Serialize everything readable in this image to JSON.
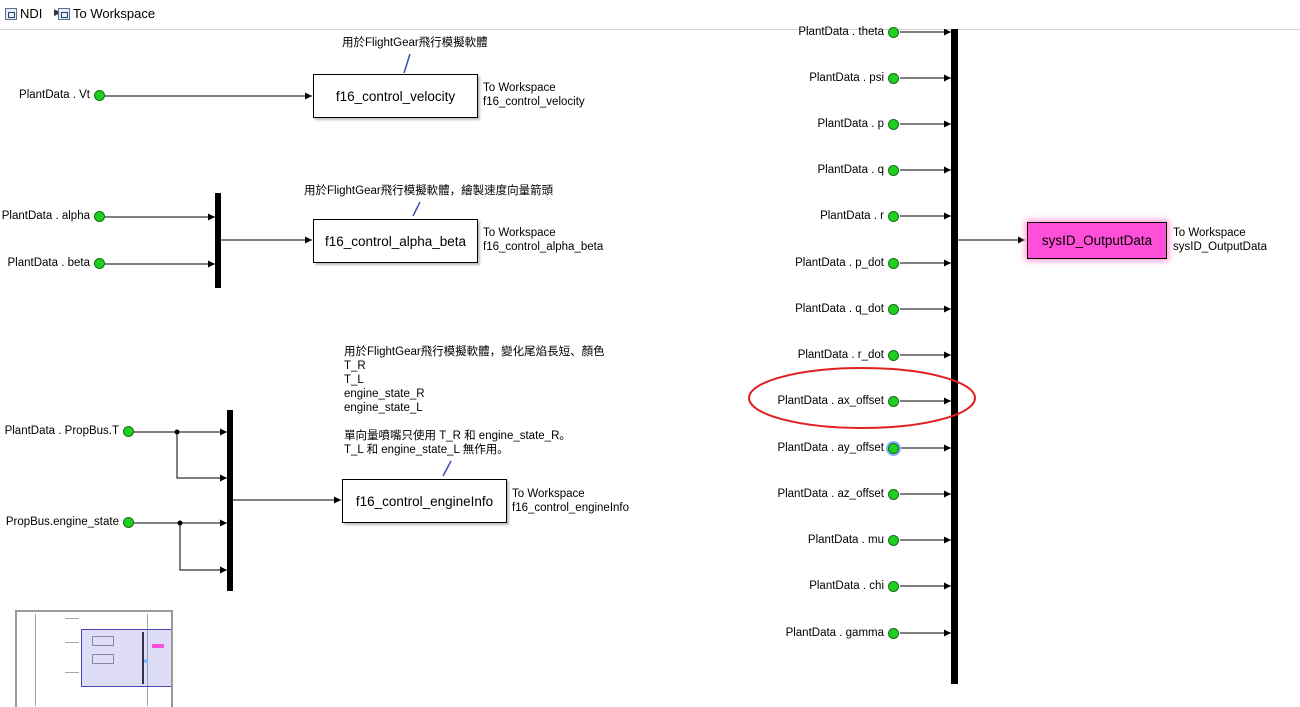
{
  "breadcrumb": {
    "root": "NDI",
    "current": "To Workspace"
  },
  "colors": {
    "port_fill": "#1fd11f",
    "highlight_block": "#ff4fd8",
    "annotation_circle": "#e02020",
    "bus": "#000000"
  },
  "inputs_left": [
    {
      "label": "PlantData . Vt"
    },
    {
      "label": "PlantData . alpha"
    },
    {
      "label": "PlantData . beta"
    },
    {
      "label": "PlantData . PropBus.T"
    },
    {
      "label": "PropBus.engine_state"
    }
  ],
  "blocks": {
    "velocity": {
      "name": "f16_control_velocity",
      "caption1": "To Workspace",
      "caption2": "f16_control_velocity",
      "note": "用於FlightGear飛行模擬軟體"
    },
    "alpha_beta": {
      "name": "f16_control_alpha_beta",
      "caption1": "To Workspace",
      "caption2": "f16_control_alpha_beta",
      "note": "用於FlightGear飛行模擬軟體，繪製速度向量箭頭"
    },
    "engine": {
      "name": "f16_control_engineInfo",
      "caption1": "To Workspace",
      "caption2": "f16_control_engineInfo",
      "note_lines": [
        "用於FlightGear飛行模擬軟體，變化尾焰長短、顏色",
        "T_R",
        "T_L",
        "engine_state_R",
        "engine_state_L",
        "",
        "單向量噴嘴只使用 T_R 和 engine_state_R。",
        "T_L 和 engine_state_L 無作用。"
      ]
    },
    "output": {
      "name": "sysID_OutputData",
      "caption1": "To Workspace",
      "caption2": "sysID_OutputData"
    }
  },
  "inputs_right": [
    {
      "label": "PlantData . theta"
    },
    {
      "label": "PlantData . psi"
    },
    {
      "label": "PlantData . p"
    },
    {
      "label": "PlantData . q"
    },
    {
      "label": "PlantData . r"
    },
    {
      "label": "PlantData . p_dot"
    },
    {
      "label": "PlantData . q_dot"
    },
    {
      "label": "PlantData . r_dot"
    },
    {
      "label": "PlantData . ax_offset"
    },
    {
      "label": "PlantData . ay_offset"
    },
    {
      "label": "PlantData . az_offset"
    },
    {
      "label": "PlantData . mu"
    },
    {
      "label": "PlantData . chi"
    },
    {
      "label": "PlantData . gamma"
    }
  ]
}
